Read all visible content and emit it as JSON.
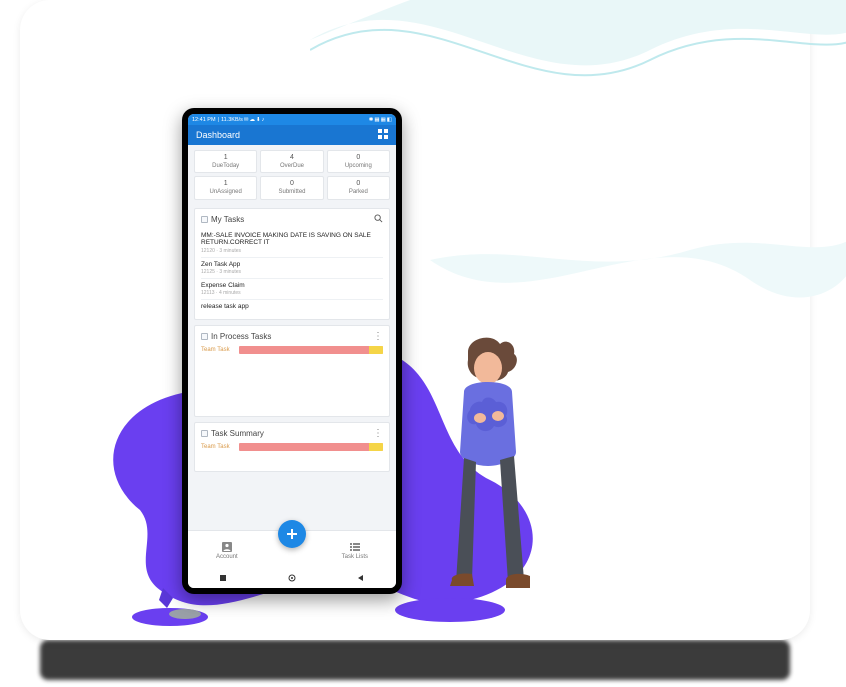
{
  "statusbar": {
    "time": "12:41 PM",
    "net": "11.3KB/s"
  },
  "appbar": {
    "title": "Dashboard"
  },
  "stats": [
    {
      "value": "1",
      "label": "DueToday"
    },
    {
      "value": "4",
      "label": "OverDue"
    },
    {
      "value": "0",
      "label": "Upcoming"
    },
    {
      "value": "1",
      "label": "UnAssigned"
    },
    {
      "value": "0",
      "label": "Submitted"
    },
    {
      "value": "0",
      "label": "Parked"
    }
  ],
  "mytasks": {
    "title": "My Tasks",
    "items": [
      {
        "title": "MM:-SALE INVOICE MAKING DATE IS SAVING ON SALE RETURN.CORRECT IT",
        "meta": "12120 · 3 minutes"
      },
      {
        "title": "Zen Task App",
        "meta": "12125 · 3 minutes"
      },
      {
        "title": "Expense Claim",
        "meta": "12113 · 4 minutes"
      },
      {
        "title": "release task app",
        "meta": ""
      }
    ]
  },
  "inprocess": {
    "title": "In Process Tasks",
    "bar_label": "Team Task"
  },
  "summary": {
    "title": "Task Summary",
    "bar_label": "Team Task"
  },
  "nav": {
    "left": "Account",
    "right": "Task Lists"
  }
}
